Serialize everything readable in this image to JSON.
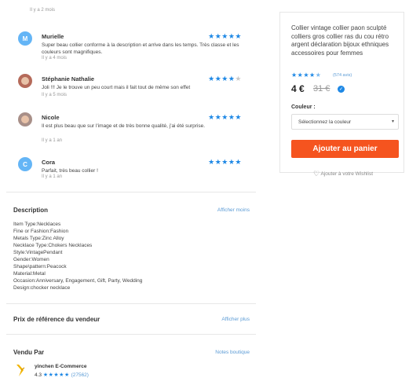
{
  "reviews": {
    "top_time": "Il y a 2 mois",
    "items": [
      {
        "initial": "M",
        "name": "Murielle",
        "stars_on": "★★★★★",
        "stars_off": "",
        "text": "Super beau collier conforme à la description et arrive dans les temps. Très classe et les couleurs sont magnifiques.",
        "time": "Il y a 4 mois"
      },
      {
        "initial": "",
        "name": "Stéphanie Nathalie",
        "stars_on": "★★★★",
        "stars_off": "★",
        "text": "Joli !!! Je le trouve un peu court mais il fait tout de même son effet",
        "time": "Il y a 5 mois"
      },
      {
        "initial": "",
        "name": "Nicole",
        "stars_on": "★★★★★",
        "stars_off": "",
        "text": "Il est plus beau que sur l'image et de très bonne qualité, j'ai été surprise.",
        "time": "Il y a 1 an"
      },
      {
        "initial": "C",
        "name": "Cora",
        "stars_on": "★★★★★",
        "stars_off": "",
        "text": "Parfait, très beau collier !",
        "time": "Il y a 1 an"
      }
    ]
  },
  "description": {
    "title": "Description",
    "toggle_label": "Afficher moins",
    "lines": [
      "Item Type:Necklaces",
      "Fine or Fashion:Fashion",
      "Metals Type:Zinc Alloy",
      "Necklace Type:Chokers Necklaces",
      "Style:VintagePendant",
      "Gender:Women",
      "Shape\\pattern:Peacock",
      "Material:Metal",
      "Occasion:Anniversary, Engagement, Gift, Party, Wedding",
      "Design:chocker necklace"
    ]
  },
  "reference_price": {
    "title": "Prix de référence du vendeur",
    "link": "Afficher plus"
  },
  "seller": {
    "title": "Vendu Par",
    "link": "Notes boutique",
    "name": "yinchen E-Commerce",
    "rating": "4.3",
    "stars": "★★★★★",
    "count": "(27562)"
  },
  "product": {
    "title": "Collier vintage collier paon sculpté colliers gros collier ras du cou rétro argent déclaration bijoux ethniques accessoires pour femmes",
    "stars": "★★★★",
    "half_star": "★",
    "rating_count": "(574 avis)",
    "price": "4 €",
    "old_price": "31 €",
    "color_label": "Couleur :",
    "color_placeholder": "Sélectionnez la couleur",
    "add_to_cart": "Ajouter au panier",
    "wishlist": "Ajouter à votre Wishlist"
  },
  "colors": {
    "accent_blue": "#1e88e5",
    "cta_orange": "#f5541f",
    "link_blue": "#5b9bd5"
  }
}
